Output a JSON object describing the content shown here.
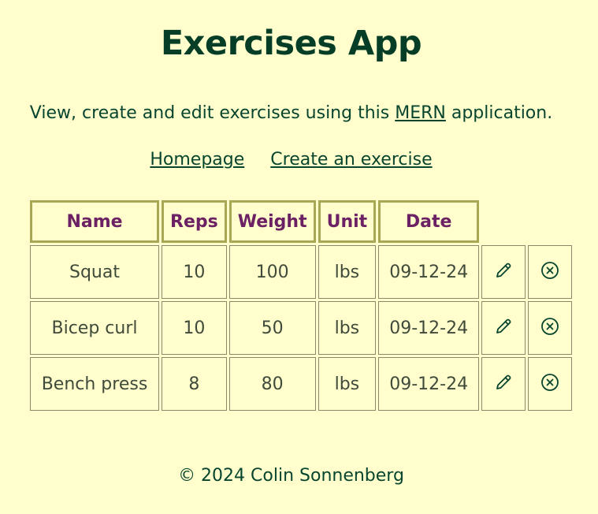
{
  "header": {
    "title": "Exercises App"
  },
  "intro": {
    "before": "View, create and edit exercises using this ",
    "link": "MERN",
    "after": " application."
  },
  "nav": {
    "home": "Homepage",
    "create": "Create an exercise"
  },
  "table": {
    "headers": [
      "Name",
      "Reps",
      "Weight",
      "Unit",
      "Date"
    ],
    "rows": [
      {
        "name": "Squat",
        "reps": "10",
        "weight": "100",
        "unit": "lbs",
        "date": "09-12-24"
      },
      {
        "name": "Bicep curl",
        "reps": "10",
        "weight": "50",
        "unit": "lbs",
        "date": "09-12-24"
      },
      {
        "name": "Bench press",
        "reps": "8",
        "weight": "80",
        "unit": "lbs",
        "date": "09-12-24"
      }
    ],
    "edit_icon": "pencil-icon",
    "delete_icon": "circle-x-icon"
  },
  "footer": {
    "text": "© 2024 Colin Sonnenberg"
  },
  "colors": {
    "background": "#fffecc",
    "heading": "#063d27",
    "header_text": "#6b2163",
    "header_border": "#a7a754"
  }
}
